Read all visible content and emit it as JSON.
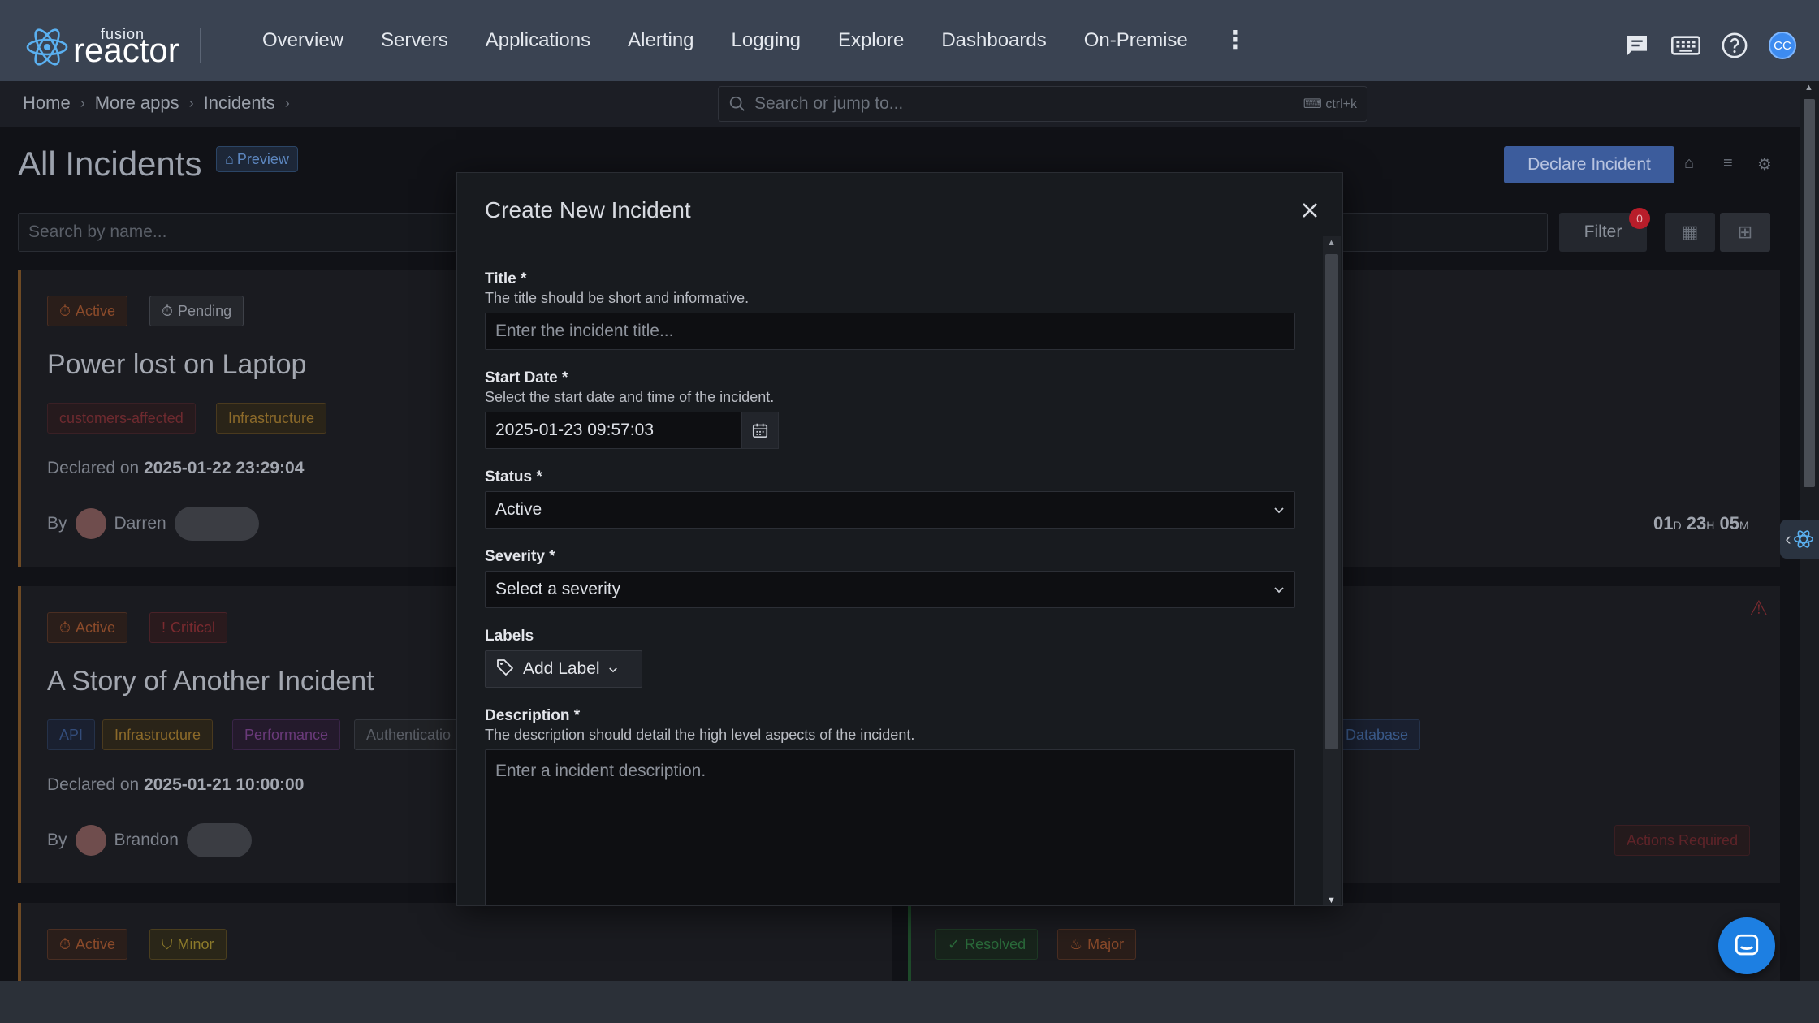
{
  "app": {
    "logo_small": "fusion",
    "logo_large": "reactor"
  },
  "nav": {
    "items": [
      "Overview",
      "Servers",
      "Applications",
      "Alerting",
      "Logging",
      "Explore",
      "Dashboards",
      "On-Premise"
    ],
    "more": "⋮",
    "avatar_initials": "CC"
  },
  "breadcrumb": [
    "Home",
    "More apps",
    "Incidents"
  ],
  "search_jump": {
    "placeholder": "Search or jump to...",
    "shortcut": "ctrl+k"
  },
  "page": {
    "title": "All Incidents",
    "preview_badge": "Preview",
    "declare_button": "Declare Incident",
    "search_placeholder": "Search by name...",
    "filter_label": "Filter",
    "filter_count": "0"
  },
  "cards": [
    {
      "status_tag": "Active",
      "second_tag": "Pending",
      "title": "Power lost on Laptop",
      "labels": [
        "customers-affected",
        "Infrastructure"
      ],
      "declared_prefix": "Declared on",
      "declared_on": "2025-01-22 23:29:04",
      "by_prefix": "By",
      "by": "Darren"
    },
    {
      "status_tag": "Active",
      "second_tag": "Critical",
      "title": "A Story of Another Incident",
      "labels": [
        "API",
        "Infrastructure",
        "Performance",
        "Authenticatio"
      ],
      "extra_label": "Database",
      "declared_prefix": "Declared on",
      "declared_on": "2025-01-21 10:00:00",
      "by_prefix": "By",
      "by": "Brandon",
      "actions_tag": "Actions Required"
    },
    {
      "status_tag": "Active",
      "second_tag": "Minor",
      "right_tags": [
        "Resolved",
        "Major"
      ]
    }
  ],
  "timer": {
    "d": "01",
    "d_unit": "D",
    "h": "23",
    "h_unit": "H",
    "m": "05",
    "m_unit": "M"
  },
  "modal": {
    "title": "Create New Incident",
    "title_field": {
      "label": "Title *",
      "description": "The title should be short and informative.",
      "placeholder": "Enter the incident title..."
    },
    "start_date": {
      "label": "Start Date *",
      "description": "Select the start date and time of the incident.",
      "value": "2025-01-23 09:57:03"
    },
    "status": {
      "label": "Status *",
      "value": "Active"
    },
    "severity": {
      "label": "Severity *",
      "placeholder": "Select a severity"
    },
    "labels": {
      "label": "Labels",
      "button": "Add Label"
    },
    "description": {
      "label": "Description *",
      "description": "The description should detail the high level aspects of the incident.",
      "placeholder": "Enter a incident description."
    }
  },
  "colors": {
    "topbar": "#3a4352",
    "accent": "#3d8bf0",
    "modal_bg": "#181b1f",
    "danger": "#b81d2a"
  }
}
